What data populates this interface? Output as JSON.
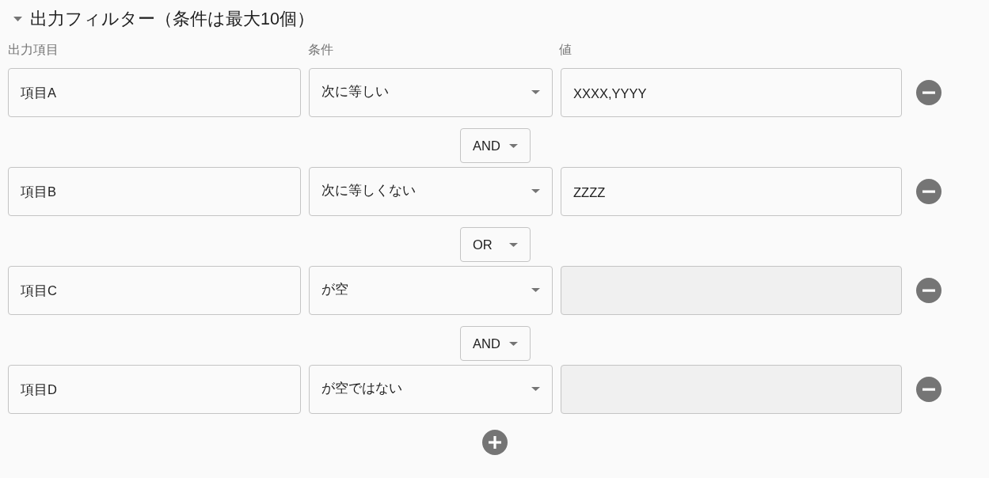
{
  "section": {
    "title": "出力フィルター（条件は最大10個）",
    "expanded": true
  },
  "columns": [
    "出力項目",
    "条件",
    "値"
  ],
  "filters": [
    {
      "item": "項目A",
      "condition": "次に等しい",
      "value": {
        "text": "XXXX,YYYY",
        "disabled": false
      }
    },
    {
      "joiner": "AND",
      "item": "項目B",
      "condition": "次に等しくない",
      "value": {
        "text": "ZZZZ",
        "disabled": false
      }
    },
    {
      "joiner": "OR",
      "item": "項目C",
      "condition": "が空",
      "value": {
        "disabled": true
      }
    },
    {
      "joiner": "AND",
      "item": "項目D",
      "condition": "が空ではない",
      "value": {
        "disabled": true
      }
    }
  ]
}
